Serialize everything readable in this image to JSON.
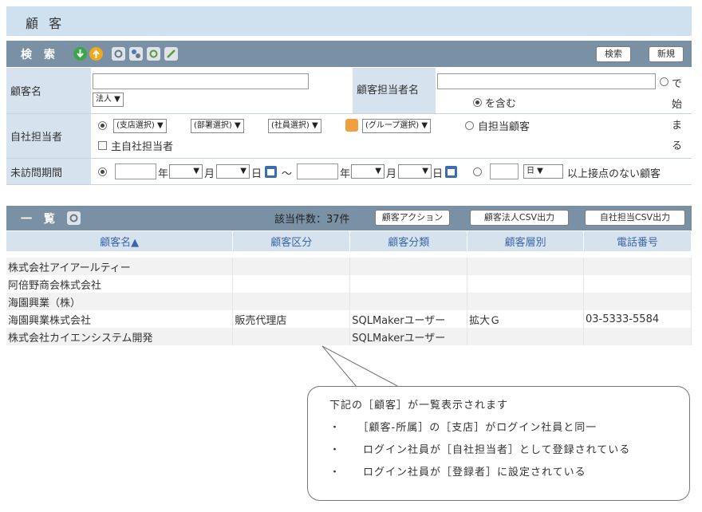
{
  "page": {
    "title": "顧 客"
  },
  "search": {
    "label": "検 索",
    "search_button": "検索",
    "new_button": "新規",
    "fields": {
      "customer_name_label": "顧客名",
      "corp_select": "法人 ▼",
      "contact_name_label": "顧客担当者名",
      "radio_starts_label": "で始まる",
      "radio_contains_label": "を含む",
      "company_rep_label": "自社担当者",
      "branch_select": "(支店選択) ▼",
      "dept_select": "(部署選択) ▼",
      "staff_select": "(社員選択) ▼",
      "group_select": "(グループ選択) ▼",
      "my_customers_label": "自担当顧客",
      "main_rep_label": "主自社担当者",
      "unvisited_label": "未訪問期間",
      "year_unit": "年",
      "month_unit": "月",
      "day_unit": "日",
      "range_sep": "～",
      "month_select": "▼",
      "day_select": "▼",
      "period_unit_select": "日 ▼",
      "no_contact_label": "以上接点のない顧客"
    }
  },
  "list": {
    "label": "一 覧",
    "count_text": "該当件数：37件",
    "buttons": [
      "顧客アクション",
      "顧客法人CSV出力",
      "自社担当CSV出力"
    ],
    "columns": [
      "顧客名▲",
      "顧客区分",
      "顧客分類",
      "顧客層別",
      "電話番号"
    ],
    "rows": [
      [
        "株式会社アイアールティー",
        "",
        "",
        "",
        ""
      ],
      [
        "阿倍野商会株式会社",
        "",
        "",
        "",
        ""
      ],
      [
        "海園興業（株）",
        "",
        "",
        "",
        ""
      ],
      [
        "海園興業株式会社",
        "販売代理店",
        "SQLMakerユーザー",
        "拡大Ｇ",
        "03-5333-5584"
      ],
      [
        "株式会社カイエンシステム開発",
        "",
        "SQLMakerユーザー",
        "",
        ""
      ]
    ]
  },
  "note": {
    "heading": "下記の［顧客］が一覧表示されます",
    "items": [
      "・　　［顧客-所属］の［支店］がログイン社員と同一",
      "・　　ログイン社員が［自社担当者］として登録されている",
      "・　　ログイン社員が［登録者］に設定されている"
    ]
  },
  "colors": {
    "header_bar": "#7a90a4",
    "label_bg": "#d6e3ee",
    "link": "#3a66a8",
    "title_bg": "#cfe0ee"
  }
}
